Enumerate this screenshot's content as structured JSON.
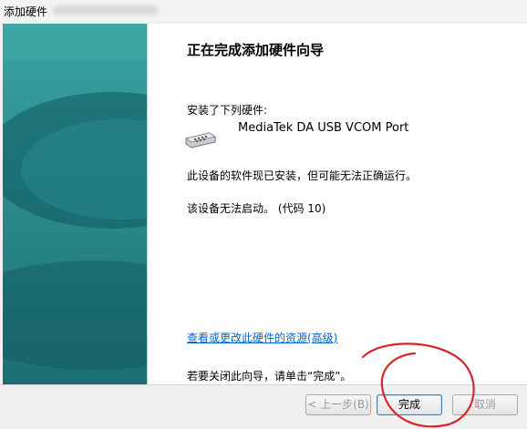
{
  "window": {
    "title": "添加硬件"
  },
  "wizard": {
    "heading": "正在完成添加硬件向导",
    "installed_label": "安装了下列硬件:",
    "device_name": "MediaTek DA USB VCOM Port",
    "status_message": "此设备的软件现已安装，但可能无法正确运行。",
    "error_message": "该设备无法启动。 (代码 10)",
    "resources_link": "查看或更改此硬件的资源(高级)",
    "close_instruction": "若要关闭此向导，请单击“完成”。"
  },
  "buttons": {
    "back": "< 上一步(B)",
    "finish": "完成",
    "cancel": "取消"
  },
  "icons": {
    "device": "serial-port-icon"
  },
  "colors": {
    "side_panel": "#1f7b7f",
    "link": "#0066cc",
    "annotation": "#d7262a"
  }
}
